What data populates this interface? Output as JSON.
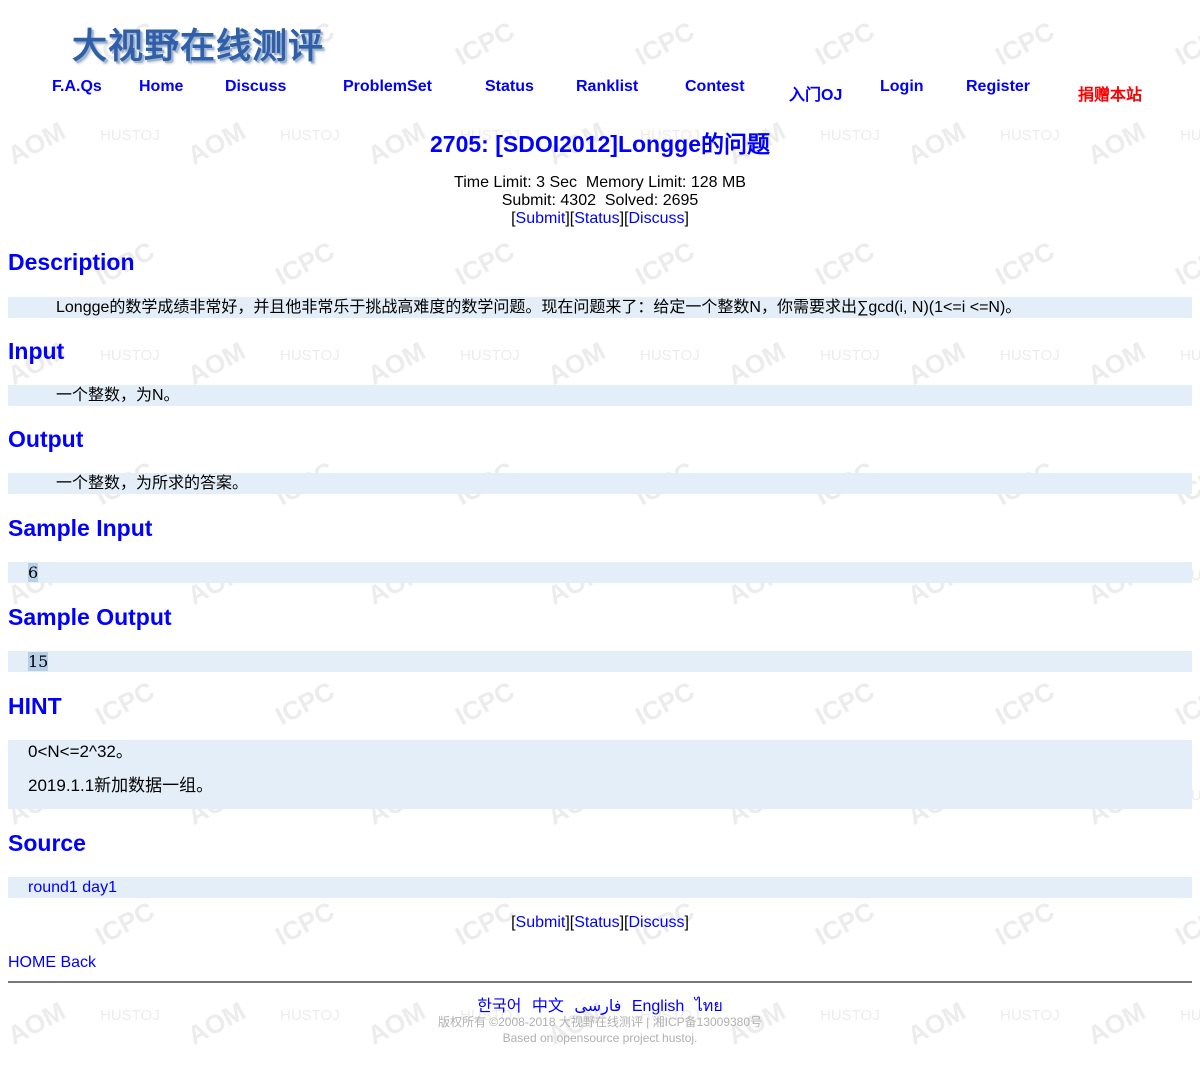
{
  "header": {
    "logo_text": "大视野在线测评"
  },
  "menu": {
    "faqs": "F.A.Qs",
    "home": "Home",
    "discuss": "Discuss",
    "problemset": "ProblemSet",
    "status": "Status",
    "ranklist": "Ranklist",
    "contest": "Contest",
    "intro_oj": "入门OJ",
    "login": "Login",
    "register": "Register",
    "donate": "捐赠本站"
  },
  "problem": {
    "title": "2705: [SDOI2012]Longge的问题",
    "time_limit_label": "Time Limit:",
    "time_limit": "3 Sec",
    "memory_limit_label": "Memory Limit:",
    "memory_limit": "128 MB",
    "submit_label": "Submit:",
    "submit_count": "4302",
    "solved_label": "Solved:",
    "solved_count": "2695",
    "links": {
      "submit": "Submit",
      "status": "Status",
      "discuss": "Discuss"
    }
  },
  "sections": {
    "description_heading": "Description",
    "description_text": "Longge的数学成绩非常好，并且他非常乐于挑战高难度的数学问题。现在问题来了：给定一个整数N，你需要求出∑gcd(i, N)(1<=i <=N)。",
    "input_heading": "Input",
    "input_text": "一个整数，为N。",
    "output_heading": "Output",
    "output_text": "一个整数，为所求的答案。",
    "sample_input_heading": "Sample Input",
    "sample_input": "6",
    "sample_output_heading": "Sample Output",
    "sample_output": "15",
    "hint_heading": "HINT",
    "hint_line1": "0<N<=2^32。",
    "hint_line2": "2019.1.1新加数据一组。",
    "source_heading": "Source",
    "source_text": "round1 day1"
  },
  "footer": {
    "home": "HOME",
    "back": "Back",
    "languages": [
      "한국어",
      "中文",
      "فارسی",
      "English",
      "ไทย"
    ],
    "copyright": "版权所有 ©2008-2018 大视野在线测评 | 湘ICP备13009380号",
    "based_on": "Based on opensource project hustoj."
  },
  "colors": {
    "link": "#0000ff",
    "donate": "#ff0000",
    "panel": "#e3eef8"
  }
}
